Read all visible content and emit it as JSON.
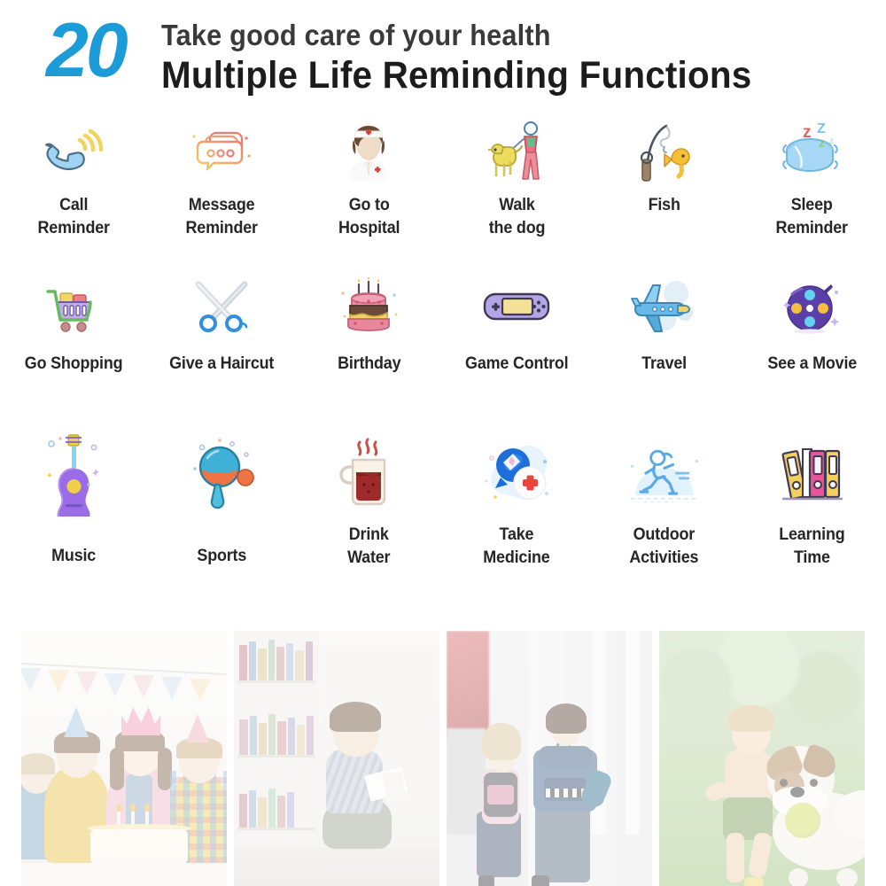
{
  "header": {
    "number": "20",
    "line1": "Take good care of your health",
    "line2": "Multiple Life Reminding Functions",
    "number_color": "#1b9bd8",
    "line1_color": "#3a3a3a",
    "line2_color": "#1c1c1c"
  },
  "features": {
    "rows": [
      {
        "items": [
          {
            "label": "Call\nReminder",
            "icon": "telephone-handset-icon",
            "colors": [
              "#8ecdf0",
              "#f2d45c"
            ]
          },
          {
            "label": "Message\nReminder",
            "icon": "speech-bubble-dots-icon",
            "colors": [
              "#ef8278",
              "#f3c65e"
            ]
          },
          {
            "label": "Go to\nHospital",
            "icon": "nurse-icon",
            "colors": [
              "#e8d9c8",
              "#e5372c"
            ]
          },
          {
            "label": "Walk\nthe dog",
            "icon": "person-walking-dog-icon",
            "colors": [
              "#e98a96",
              "#e8cf4a"
            ]
          },
          {
            "label": "Fish",
            "icon": "fishing-rod-icon",
            "colors": [
              "#6b6f76",
              "#f5c033"
            ]
          },
          {
            "label": "Sleep\nReminder",
            "icon": "pillow-zzz-icon",
            "colors": [
              "#9ed2f3",
              "#e8615f"
            ]
          }
        ]
      },
      {
        "items": [
          {
            "label": "Go Shopping",
            "icon": "shopping-cart-icon",
            "colors": [
              "#67bb5e",
              "#b9a4e2"
            ]
          },
          {
            "label": "Give a Haircut",
            "icon": "scissors-icon",
            "colors": [
              "#2f8fe0",
              "#d7dce2"
            ]
          },
          {
            "label": "Birthday",
            "icon": "birthday-cake-icon",
            "colors": [
              "#e8859c",
              "#f2d06b"
            ]
          },
          {
            "label": "Game Control",
            "icon": "handheld-console-icon",
            "colors": [
              "#b3a6e8",
              "#f5e09a"
            ]
          },
          {
            "label": "Travel",
            "icon": "airplane-icon",
            "colors": [
              "#6ab8e8",
              "#dbe9f5"
            ]
          },
          {
            "label": "See a Movie",
            "icon": "film-reel-icon",
            "colors": [
              "#5b3fa8",
              "#f3c03f"
            ]
          }
        ]
      },
      {
        "items": [
          {
            "label": "Music",
            "icon": "guitar-icon",
            "colors": [
              "#9b6ce8",
              "#f2cf4a"
            ]
          },
          {
            "label": "Sports",
            "icon": "ping-pong-paddle-icon",
            "colors": [
              "#3fb0d8",
              "#ef7445"
            ]
          },
          {
            "label": "Drink\nWater",
            "icon": "coffee-mug-icon",
            "colors": [
              "#9e2a2a",
              "#f5efe2"
            ]
          },
          {
            "label": "Take\nMedicine",
            "icon": "medicine-bubble-icon",
            "colors": [
              "#1e6fd9",
              "#e8443c"
            ]
          },
          {
            "label": "Outdoor\nActivities",
            "icon": "running-person-icon",
            "colors": [
              "#5aa9e8",
              "#dbeffb"
            ]
          },
          {
            "label": "Learning\nTime",
            "icon": "binders-books-icon",
            "colors": [
              "#f2cf5e",
              "#e8559b"
            ]
          }
        ]
      }
    ]
  },
  "photos": [
    {
      "alt": "Children blowing out candles on a birthday cake at a party"
    },
    {
      "alt": "Boy sitting on the floor reading a book in a library"
    },
    {
      "alt": "Children with school backpacks walking toward a school building"
    },
    {
      "alt": "Young boy running on grass with a dog carrying a tennis ball"
    }
  ]
}
